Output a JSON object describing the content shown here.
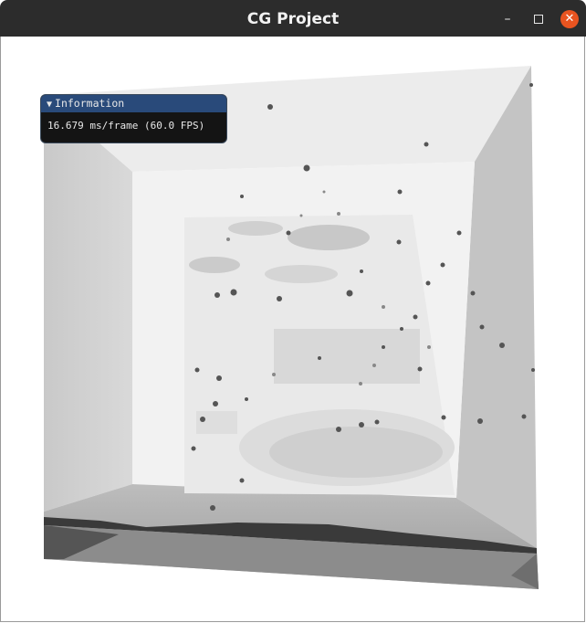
{
  "window": {
    "title": "CG Project",
    "minimize_glyph": "–",
    "close_glyph": "✕"
  },
  "overlay": {
    "header": "Information",
    "arrow": "▼",
    "stats": "16.679 ms/frame (60.0 FPS)"
  },
  "colors": {
    "titlebar": "#2c2c2c",
    "close_button": "#e95420",
    "panel_header": "#294a7a",
    "panel_bg": "#141414"
  }
}
